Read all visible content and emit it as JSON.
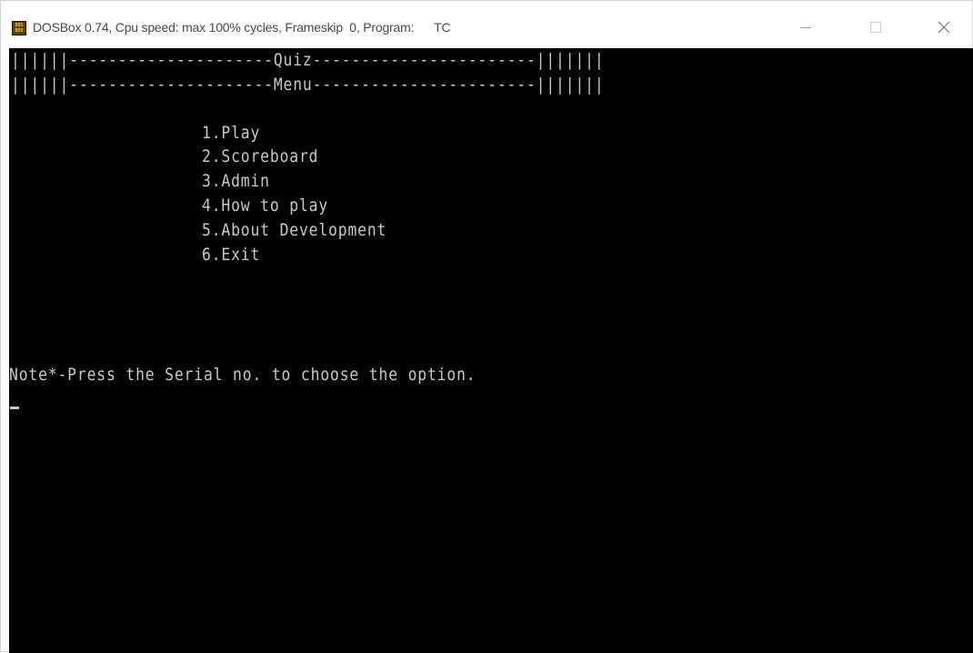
{
  "window": {
    "title": "DOSBox 0.74, Cpu speed: max 100% cycles, Frameskip  0, Program:      TC",
    "icon": "dosbox-icon",
    "icon_text": "DOS BOX",
    "controls": {
      "minimize_icon": "minimize-icon",
      "maximize_icon": "maximize-icon",
      "close_icon": "close-icon"
    }
  },
  "screen": {
    "banner_top": "||||||---------------------Quiz-----------------------|||||||",
    "banner_bottom": "||||||---------------------Menu-----------------------|||||||",
    "menu": [
      "1.Play",
      "2.Scoreboard",
      "3.Admin",
      "4.How to play",
      "5.About Development",
      "6.Exit"
    ],
    "note": "Note*-Press the Serial no. to choose the option."
  },
  "colors": {
    "terminal_bg": "#000000",
    "terminal_fg": "#c8c8c8",
    "titlebar_bg": "#ffffff",
    "title_text": "#4a4a4a"
  }
}
